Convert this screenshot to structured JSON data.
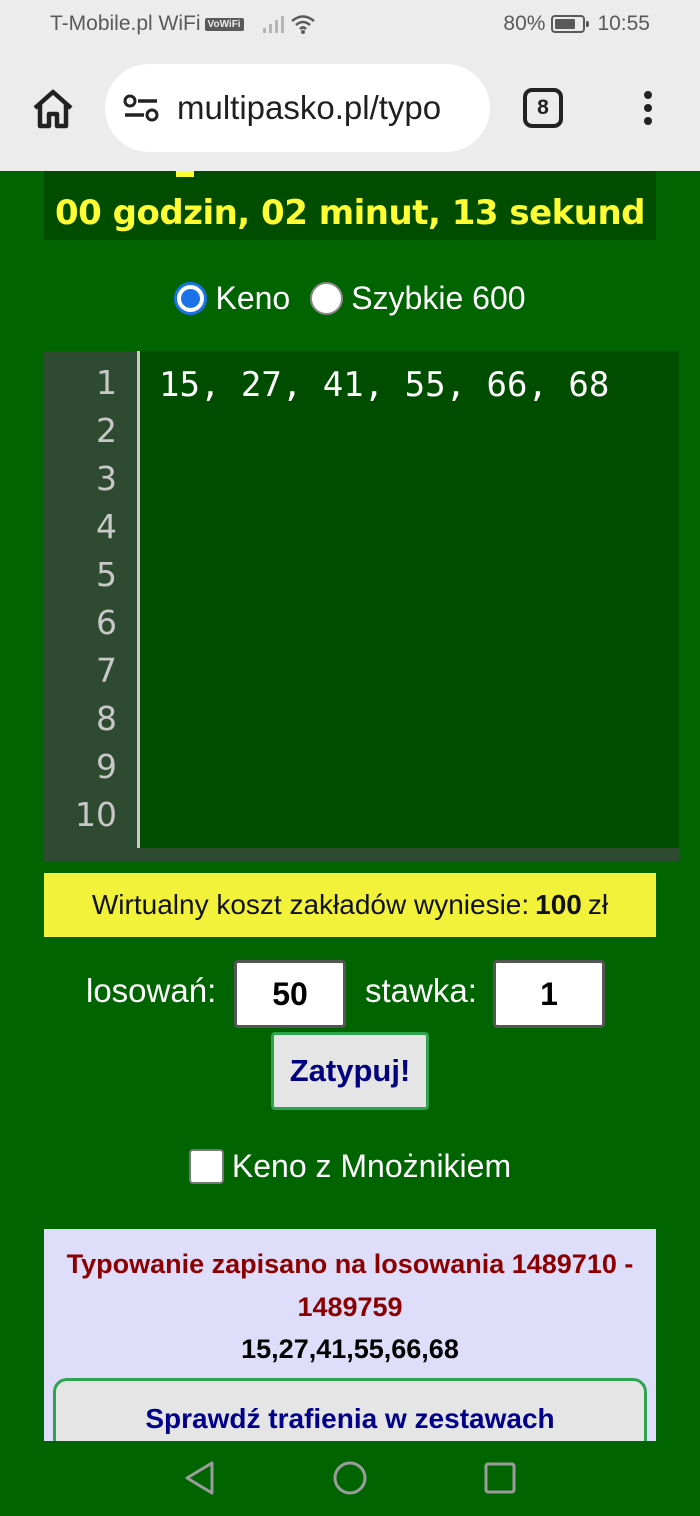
{
  "status_bar": {
    "carrier": "T-Mobile.pl WiFi",
    "vowifi_badge": "VoWiFi",
    "battery": "80%",
    "battery_level": 0.8,
    "time": "10:55"
  },
  "browser": {
    "url": "multipasko.pl/typo",
    "tab_count": "8"
  },
  "page": {
    "timer": "00 godzin, 02 minut, 13 sekund",
    "game_options": [
      {
        "label": "Keno",
        "checked": true
      },
      {
        "label": "Szybkie 600",
        "checked": false
      }
    ],
    "editor": {
      "line_numbers": [
        "1",
        "2",
        "3",
        "4",
        "5",
        "6",
        "7",
        "8",
        "9",
        "10"
      ],
      "content": "15, 27, 41, 55, 66, 68"
    },
    "cost": {
      "label": "Wirtualny koszt zakładów wyniesie:",
      "amount": "100",
      "currency": "zł"
    },
    "draws_label": "losowań:",
    "draws_value": "50",
    "stake_label": "stawka:",
    "stake_value": "1",
    "submit_label": "Zatypuj!",
    "multiplier_label": "Keno z Mnożnikiem",
    "multiplier_checked": false,
    "result": {
      "title": "Typowanie zapisano na losowania 1489710 - 1489759",
      "numbers": "15,27,41,55,66,68",
      "check_button": "Sprawdź trafienia w zestawach"
    }
  },
  "colors": {
    "page_bg": "#006400",
    "timer_text": "#ffff33",
    "cost_bg": "#f2f23a",
    "result_bg": "#dedefa",
    "result_title": "#8b0000",
    "button_text": "#000080"
  }
}
